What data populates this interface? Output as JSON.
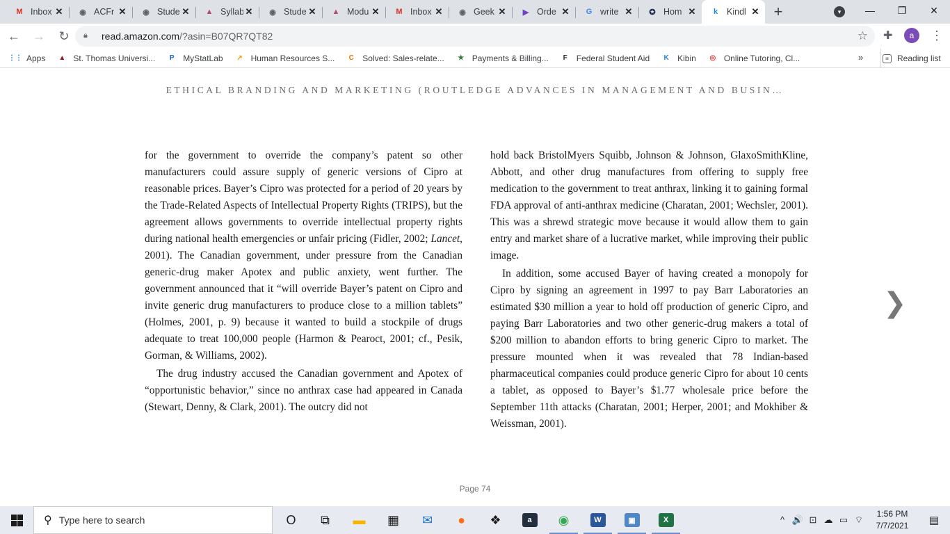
{
  "tabs": [
    {
      "title": "Inbox",
      "icon": "gmail-icon",
      "color": "#d93025",
      "glyph": "M"
    },
    {
      "title": "ACFr",
      "icon": "globe-icon",
      "color": "#5f6368",
      "glyph": "◉"
    },
    {
      "title": "Stude",
      "icon": "globe-icon",
      "color": "#5f6368",
      "glyph": "◉"
    },
    {
      "title": "Syllab",
      "icon": "canvas-icon",
      "color": "#b24a7a",
      "glyph": "▲"
    },
    {
      "title": "Stude",
      "icon": "globe-icon",
      "color": "#5f6368",
      "glyph": "◉"
    },
    {
      "title": "Modu",
      "icon": "canvas-icon",
      "color": "#b24a7a",
      "glyph": "▲"
    },
    {
      "title": "Inbox",
      "icon": "gmail-icon",
      "color": "#d93025",
      "glyph": "M"
    },
    {
      "title": "Geek",
      "icon": "globe-icon",
      "color": "#5f6368",
      "glyph": "◉"
    },
    {
      "title": "Orde",
      "icon": "play-icon",
      "color": "#6f42c1",
      "glyph": "▶"
    },
    {
      "title": "write",
      "icon": "google-icon",
      "color": "#4285f4",
      "glyph": "G"
    },
    {
      "title": "Hom",
      "icon": "hub-icon",
      "color": "#1a2b4c",
      "glyph": "✪"
    },
    {
      "title": "Kindl",
      "icon": "kindle-icon",
      "color": "#1e88e5",
      "glyph": "k",
      "active": true
    }
  ],
  "window": {
    "minimize": "—",
    "maximize": "❐",
    "close": "✕"
  },
  "address": {
    "host": "read.amazon.com",
    "path": "/?asin=B07QR7QT82"
  },
  "profile": {
    "initial": "a"
  },
  "bookmarks": [
    {
      "label": "Apps",
      "icon": "apps-grid-icon",
      "color": "#1a73e8",
      "glyph": "⋮⋮"
    },
    {
      "label": "St. Thomas Universi...",
      "icon": "university-icon",
      "color": "#8b1a1a",
      "glyph": "▲"
    },
    {
      "label": "MyStatLab",
      "icon": "mystatlab-icon",
      "color": "#1565c0",
      "glyph": "P"
    },
    {
      "label": "Human Resources S...",
      "icon": "chart-icon",
      "color": "#f29900",
      "glyph": "↗"
    },
    {
      "label": "Solved: Sales-relate...",
      "icon": "chegg-icon",
      "color": "#eb7100",
      "glyph": "C"
    },
    {
      "label": "Payments & Billing...",
      "icon": "star-icon",
      "color": "#2e7d32",
      "glyph": "★"
    },
    {
      "label": "Federal Student Aid",
      "icon": "fsa-icon",
      "color": "#263238",
      "glyph": "F"
    },
    {
      "label": "Kibin",
      "icon": "kibin-icon",
      "color": "#1e88e5",
      "glyph": "K"
    },
    {
      "label": "Online Tutoring, Cl...",
      "icon": "tutoring-icon",
      "color": "#e53935",
      "glyph": "◎"
    }
  ],
  "bookmarks_more": "»",
  "reading_list": "Reading list",
  "book": {
    "title": "ETHICAL BRANDING AND MARKETING (ROUTLEDGE ADVANCES IN MANAGEMENT AND BUSIN…",
    "page_label": "Page 74",
    "left_p1_a": "for the government to override the company’s patent so other manufacturers could assure supply of generic versions of Cipro at reasonable prices. Bayer’s Cipro was protected for a period of 20 years by the Trade-Related Aspects of Intellectual Property Rights (TRIPS), but the agreement allows governments to override intellectual property rights during national health emergencies or unfair pricing (Fidler, 2002; ",
    "left_p1_italic": "Lancet",
    "left_p1_b": ", 2001). The Canadian government, under pressure from the Canadian generic-drug maker Apotex and public anxiety, went further. The government announced that it “will override Bayer’s patent on Cipro and invite generic drug manufacturers to produce close to a million tablets” (Holmes, 2001, p. 9) because it wanted to build a stockpile of drugs adequate to treat 100,000 people (Harmon & Pearoct, 2001; cf., Pesik, Gorman, & Williams, 2002).",
    "left_p2": "The drug industry accused the Canadian government and Apotex of “opportunistic behavior,” since no anthrax case had appeared in Canada (Stewart, Denny, & Clark, 2001). The outcry did not",
    "right_p1": "hold back BristolMyers Squibb, Johnson & Johnson, GlaxoSmithKline, Abbott, and other drug manufactures from offering to supply free medication to the government to treat anthrax, linking it to gaining formal FDA approval of anti-anthrax medicine (Charatan, 2001; Wechsler, 2001). This was a shrewd strategic move because it would allow them to gain entry and market share of a lucrative market, while improving their public image.",
    "right_p2": "In addition, some accused Bayer of having created a monopoly for Cipro by signing an agreement in 1997 to pay Barr Laboratories an estimated $30 million a year to hold off production of generic Cipro, and paying Barr Laboratories and two other generic-drug makers a total of $200 million to abandon efforts to bring generic Cipro to market. The pressure mounted when it was revealed that 78 Indian-based pharmaceutical companies could produce generic Cipro for about 10 cents a tablet, as opposed to Bayer’s $1.77 wholesale price before the September 11th attacks (Charatan, 2001; Herper, 2001; and Mokhiber & Weissman, 2001)."
  },
  "taskbar": {
    "search_placeholder": "Type here to search",
    "apps": [
      {
        "name": "cortana-icon",
        "glyph": "O",
        "color": "#1b1b1b",
        "bg": ""
      },
      {
        "name": "task-view-icon",
        "glyph": "⧉",
        "color": "#1b1b1b",
        "bg": ""
      },
      {
        "name": "file-explorer-icon",
        "glyph": "▬",
        "color": "#f4b400",
        "bg": ""
      },
      {
        "name": "store-icon",
        "glyph": "▦",
        "color": "#1b1b1b",
        "bg": ""
      },
      {
        "name": "mail-icon",
        "glyph": "✉",
        "color": "#1e73d8",
        "bg": ""
      },
      {
        "name": "firefox-icon",
        "glyph": "●",
        "color": "#ff6d1f",
        "bg": ""
      },
      {
        "name": "dropbox-icon",
        "glyph": "❖",
        "color": "#1b1b1b",
        "bg": ""
      },
      {
        "name": "amazon-icon",
        "glyph": "a",
        "color": "#fff",
        "bg": "#232f3e"
      },
      {
        "name": "chrome-icon",
        "glyph": "◉",
        "color": "#34a853",
        "bg": "",
        "running": true
      },
      {
        "name": "word-icon",
        "glyph": "W",
        "color": "#fff",
        "bg": "#2b579a",
        "running": true
      },
      {
        "name": "remote-desktop-icon",
        "glyph": "▣",
        "color": "#fff",
        "bg": "#4f86c6",
        "running": true
      },
      {
        "name": "excel-icon",
        "glyph": "X",
        "color": "#fff",
        "bg": "#217346",
        "running": true
      }
    ],
    "tray": [
      "^",
      "🔊",
      "⊡",
      "☁",
      "▭",
      "⌔"
    ],
    "time": "1:56 PM",
    "date": "7/7/2021",
    "notification": "▤"
  }
}
